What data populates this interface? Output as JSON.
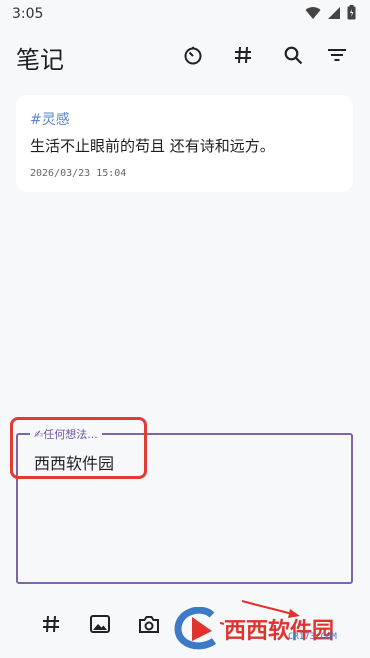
{
  "status_bar": {
    "time": "3:05",
    "icons": [
      "wifi-icon",
      "signal-icon",
      "battery-icon"
    ]
  },
  "app_bar": {
    "title": "笔记",
    "actions": [
      "timer-icon",
      "hashtag-icon",
      "search-icon",
      "filter-icon"
    ]
  },
  "notes": [
    {
      "tag": "#灵感",
      "content": "生活不止眼前的苟且 还有诗和远方。",
      "timestamp": "2026/03/23 15:04"
    }
  ],
  "editor": {
    "legend": "✍任何想法...",
    "value": "西西软件园"
  },
  "bottom_bar": {
    "actions": [
      "hashtag-icon",
      "image-icon",
      "camera-icon"
    ]
  },
  "watermark": {
    "text": "西西软件园",
    "subtext": "CR173.COM"
  },
  "colors": {
    "accent": "#7b64a8",
    "tag": "#5a86c8",
    "highlight": "#e23b36",
    "background": "#f7f8fa"
  }
}
